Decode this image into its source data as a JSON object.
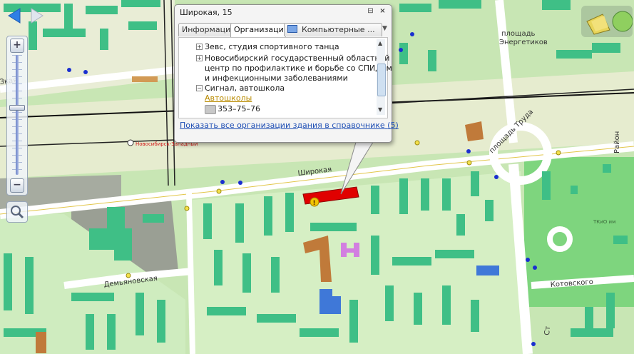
{
  "popup": {
    "title": "Широкая, 15",
    "tabs": [
      "Информация",
      "Организации",
      "Компьютерные ..."
    ],
    "active_tab": "Организации",
    "organizations": [
      {
        "name": "Зевс, студия спортивного танца",
        "toggle": "+"
      },
      {
        "name": "Новосибирский государственный областной",
        "toggle": "+",
        "lines": [
          "центр по профилактике и борьбе со СПИДом",
          "и инфекционными заболеваниями"
        ]
      },
      {
        "name": "Сигнал, автошкола",
        "toggle": "−",
        "category": "Автошколы",
        "phone": "353–75–76"
      }
    ],
    "show_all_link": "Показать все организации здания в справочнике",
    "show_all_count": "(5)"
  },
  "map": {
    "streets": {
      "shirokaya": "Широкая",
      "demyanovskaya": "Демьяновская",
      "ploshchad_truda": "площадь Труда",
      "energetikov_1": "площадь",
      "energetikov_2": "Энергетиков",
      "kotovskogo": "Котовского",
      "zagorsk_left": "Зкая",
      "raion_right": "Район",
      "st_bottom": "Ст",
      "railway_station": "Новосибирск-Западный",
      "tkio": "ТКиО им"
    },
    "colors": {
      "grass": "#c8e6b4",
      "block": "#e9edd6",
      "park": "#7ed57e",
      "building": "#3fbf86",
      "highlight": "#e00000",
      "road": "#ffffff",
      "railway": "#111111"
    }
  },
  "icons": {
    "back": "back-arrow-icon",
    "forward": "forward-arrow-icon",
    "zoom_in": "+",
    "zoom_out": "−",
    "magnifier": "magnifier-icon",
    "layers": "layers-icon",
    "pin": "pin-icon",
    "close": "×"
  }
}
